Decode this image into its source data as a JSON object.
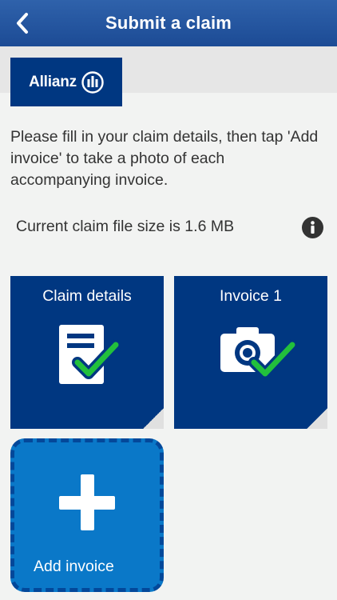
{
  "navbar": {
    "title": "Submit a claim",
    "back_icon": "chevron-left-icon"
  },
  "brand": {
    "name": "Allianz",
    "color": "#003781"
  },
  "intro_text": "Please fill in your claim details, then tap 'Add invoice' to take a photo of each accompanying invoice.",
  "file_size": {
    "text": "Current claim file size is 1.6 MB",
    "info_icon": "info-icon"
  },
  "tiles": [
    {
      "label": "Claim details",
      "icon": "document-check-icon"
    },
    {
      "label": "Invoice 1",
      "icon": "camera-check-icon"
    }
  ],
  "add_invoice": {
    "label": "Add invoice",
    "icon": "plus-icon"
  },
  "colors": {
    "navbar": "#2457a1",
    "tile": "#003781",
    "add_tile": "#0a78c8",
    "check": "#22c03c"
  }
}
